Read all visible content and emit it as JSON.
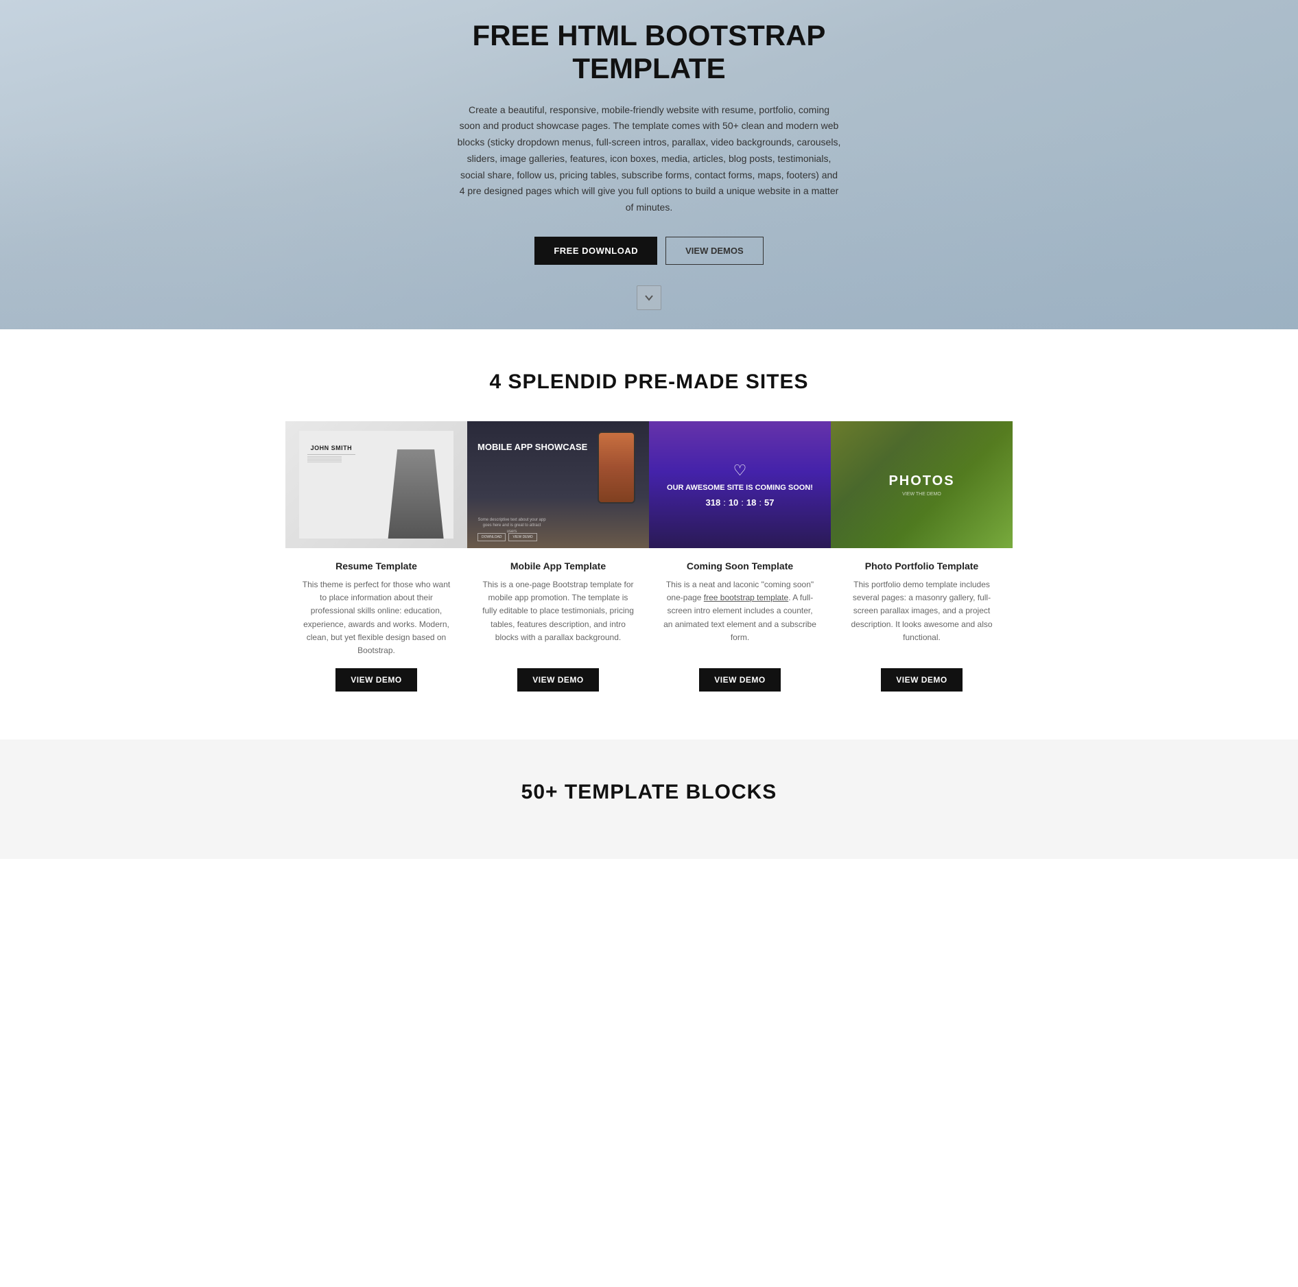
{
  "hero": {
    "title": "FREE HTML BOOTSTRAP TEMPLATE",
    "description": "Create a beautiful, responsive, mobile-friendly website with resume, portfolio, coming soon and product showcase pages. The template comes with 50+ clean and modern web blocks (sticky dropdown menus, full-screen intros, parallax, video backgrounds, carousels, sliders, image galleries, features, icon boxes, media, articles, blog posts, testimonials, social share, follow us, pricing tables, subscribe forms, contact forms, maps, footers) and 4 pre designed pages which will give you full options to build a unique website in a matter of minutes.",
    "btn_download": "FREE DOWNLOAD",
    "btn_demos": "VIEW DEMOS"
  },
  "sites_section": {
    "title": "4 SPLENDID PRE-MADE SITES",
    "cards": [
      {
        "id": "resume",
        "title": "Resume Template",
        "description": "This theme is perfect for those who want to place information about their professional skills online: education, experience, awards and works. Modern, clean, but yet flexible design based on Bootstrap.",
        "btn_label": "VIEW DEMO",
        "person_name": "JOHN SMITH"
      },
      {
        "id": "mobile",
        "title": "Mobile App Template",
        "description": "This is a one-page Bootstrap template for mobile app promotion. The template is fully editable to place testimonials, pricing tables, features description, and intro blocks with a parallax background.",
        "btn_label": "VIEW DEMO",
        "showcase_title": "MOBILE APP SHOWCASE",
        "sub_text": "Some descriptive text about your app goes here and is great to attract users"
      },
      {
        "id": "coming",
        "title": "Coming Soon Template",
        "description": "This is a neat and laconic \"coming soon\" one-page free bootstrap template. A full-screen intro element includes a counter, an animated text element and a subscribe form.",
        "btn_label": "VIEW DEMO",
        "coming_title": "OUR AWESOME SITE IS COMING SOON!",
        "countdown": {
          "days": "318",
          "hours": "10",
          "minutes": "18",
          "seconds": "57"
        }
      },
      {
        "id": "photos",
        "title": "Photo Portfolio Template",
        "description": "This portfolio demo template includes several pages: a masonry gallery, full-screen parallax images, and a project description. It looks awesome and also functional.",
        "btn_label": "VIEW DEMO",
        "photos_title": "PHOTOS",
        "photos_sub": "VIEW THE DEMO"
      }
    ]
  },
  "blocks_section": {
    "title": "50+ TEMPLATE BLOCKS"
  }
}
